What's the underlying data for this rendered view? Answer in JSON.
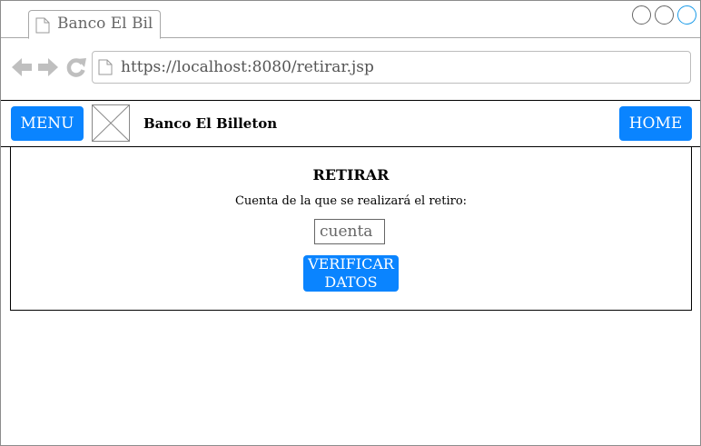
{
  "browser": {
    "tab_title": "Banco El Bil",
    "url": "https://localhost:8080/retirar.jsp",
    "icons": [
      "document-icon",
      "back-arrow-icon",
      "forward-arrow-icon",
      "reload-icon"
    ]
  },
  "header": {
    "menu_label": "MENU",
    "brand": "Banco El Billeton",
    "home_label": "HOME",
    "accent_color": "#0a84ff"
  },
  "main": {
    "title": "RETIRAR",
    "account_label": "Cuenta de la que se realizará el retiro:",
    "account_placeholder": "cuenta",
    "verify_line1": "VERIFICAR",
    "verify_line2": "DATOS"
  }
}
